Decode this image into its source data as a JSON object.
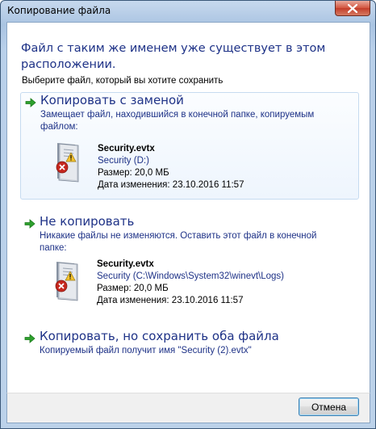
{
  "window": {
    "title": "Копирование файла",
    "heading": "Файл с таким же именем уже существует в этом расположении.",
    "subheading": "Выберите файл, который вы хотите сохранить"
  },
  "options": [
    {
      "title": "Копировать с заменой",
      "description": "Замещает файл, находившийся в конечной папке, копируемым файлом:",
      "file": {
        "name": "Security.evtx",
        "location": "Security (D:)",
        "size": "Размер: 20,0 МБ",
        "modified": "Дата изменения: 23.10.2016 11:57"
      }
    },
    {
      "title": "Не копировать",
      "description": "Никакие файлы не изменяются. Оставить этот файл в конечной папке:",
      "file": {
        "name": "Security.evtx",
        "location": "Security (C:\\Windows\\System32\\winevt\\Logs)",
        "size": "Размер: 20,0 МБ",
        "modified": "Дата изменения: 23.10.2016 11:57"
      }
    },
    {
      "title": "Копировать, но сохранить оба файла",
      "description": "Копируемый файл получит имя \"Security (2).evtx\""
    }
  ],
  "footer": {
    "cancel_label": "Отмена"
  },
  "icons": {
    "close": "close-icon",
    "arrow": "green-arrow-icon",
    "file": "event-log-file-icon",
    "warning": "warning-icon",
    "error": "error-icon"
  },
  "colors": {
    "heading_text": "#1e3287",
    "option_hover_bg": "#eef5fd",
    "arrow": "#2ea12e",
    "close_button": "#c43d2a"
  }
}
